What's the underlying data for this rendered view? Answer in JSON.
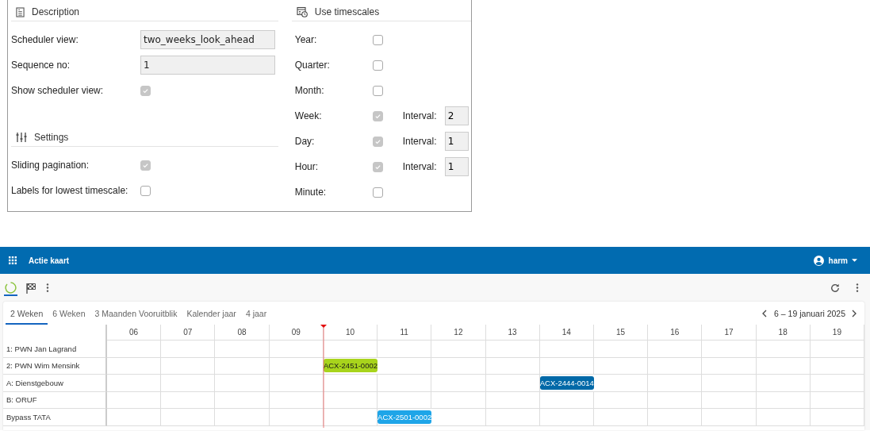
{
  "description": {
    "title": "Description",
    "fields": [
      {
        "label": "Scheduler view:",
        "kind": "text",
        "value": "two_weeks_look_ahead"
      },
      {
        "label": "Sequence no:",
        "kind": "text",
        "value": "1"
      },
      {
        "label": "Show scheduler view:",
        "kind": "checkbox",
        "checked": true
      }
    ]
  },
  "settings": {
    "title": "Settings",
    "fields": [
      {
        "label": "Sliding pagination:",
        "kind": "checkbox",
        "checked": true
      },
      {
        "label": "Labels for lowest timescale:",
        "kind": "checkbox",
        "checked": false
      }
    ]
  },
  "timescales": {
    "title": "Use timescales",
    "rows": [
      {
        "label": "Year:",
        "checked": false
      },
      {
        "label": "Quarter:",
        "checked": false
      },
      {
        "label": "Month:",
        "checked": false
      },
      {
        "label": "Week:",
        "checked": true,
        "interval": {
          "label": "Interval:",
          "value": "2"
        }
      },
      {
        "label": "Day:",
        "checked": true,
        "interval": {
          "label": "Interval:",
          "value": "1"
        }
      },
      {
        "label": "Hour:",
        "checked": true,
        "interval": {
          "label": "Interval:",
          "value": "1"
        }
      },
      {
        "label": "Minute:",
        "checked": false
      }
    ]
  },
  "app_bar": {
    "title": "Actie kaart",
    "user": "harm"
  },
  "tabs": [
    {
      "label": "2 Weken",
      "selected": true
    },
    {
      "label": "6 Weken",
      "selected": false
    },
    {
      "label": "3 Maanden Vooruitblik",
      "selected": false
    },
    {
      "label": "Kalender jaar",
      "selected": false
    },
    {
      "label": "4 jaar",
      "selected": false
    }
  ],
  "date_range": "6 – 19 januari 2025",
  "days": [
    {
      "label": "06",
      "today": false
    },
    {
      "label": "07",
      "today": false
    },
    {
      "label": "08",
      "today": false
    },
    {
      "label": "09",
      "today": false
    },
    {
      "label": "10",
      "today": true
    },
    {
      "label": "11",
      "today": false
    },
    {
      "label": "12",
      "today": false
    },
    {
      "label": "13",
      "today": false
    },
    {
      "label": "14",
      "today": false
    },
    {
      "label": "15",
      "today": false
    },
    {
      "label": "16",
      "today": false
    },
    {
      "label": "17",
      "today": false
    },
    {
      "label": "18",
      "today": false
    },
    {
      "label": "19",
      "today": false
    }
  ],
  "resources": [
    {
      "name": "1: PWN Jan Lagrand",
      "cells": [
        {
          "kind": "empty"
        },
        {
          "kind": "empty"
        },
        {
          "kind": "empty"
        },
        {
          "kind": "empty"
        },
        {
          "kind": "empty"
        },
        {
          "kind": "empty"
        },
        {
          "kind": "empty"
        },
        {
          "kind": "empty"
        },
        {
          "kind": "empty"
        },
        {
          "kind": "empty"
        },
        {
          "kind": "empty"
        },
        {
          "kind": "empty"
        },
        {
          "kind": "empty"
        },
        {
          "kind": "empty"
        }
      ]
    },
    {
      "name": "2: PWN Wim Mensink",
      "cells": [
        {
          "kind": "empty"
        },
        {
          "kind": "empty"
        },
        {
          "kind": "empty"
        },
        {
          "kind": "empty"
        },
        {
          "kind": "event",
          "label": "ACX-2451-0002",
          "color": "#a8d41c"
        },
        {
          "kind": "empty"
        },
        {
          "kind": "empty"
        },
        {
          "kind": "empty"
        },
        {
          "kind": "empty"
        },
        {
          "kind": "empty"
        },
        {
          "kind": "empty"
        },
        {
          "kind": "empty"
        },
        {
          "kind": "empty"
        },
        {
          "kind": "empty"
        }
      ]
    },
    {
      "name": "A: Dienstgebouw",
      "cells": [
        {
          "kind": "empty"
        },
        {
          "kind": "empty"
        },
        {
          "kind": "empty"
        },
        {
          "kind": "empty"
        },
        {
          "kind": "empty"
        },
        {
          "kind": "empty"
        },
        {
          "kind": "empty"
        },
        {
          "kind": "empty"
        },
        {
          "kind": "event",
          "label": "ACX-2444-0014",
          "color": "#0169a8"
        },
        {
          "kind": "empty"
        },
        {
          "kind": "empty"
        },
        {
          "kind": "empty"
        },
        {
          "kind": "empty"
        },
        {
          "kind": "empty"
        }
      ]
    },
    {
      "name": "B: ORUF",
      "cells": [
        {
          "kind": "empty"
        },
        {
          "kind": "empty"
        },
        {
          "kind": "empty"
        },
        {
          "kind": "empty"
        },
        {
          "kind": "empty"
        },
        {
          "kind": "empty"
        },
        {
          "kind": "empty"
        },
        {
          "kind": "empty"
        },
        {
          "kind": "empty"
        },
        {
          "kind": "empty"
        },
        {
          "kind": "empty"
        },
        {
          "kind": "empty"
        },
        {
          "kind": "empty"
        },
        {
          "kind": "empty"
        }
      ]
    },
    {
      "name": "Bypass TATA",
      "cells": [
        {
          "kind": "empty"
        },
        {
          "kind": "empty"
        },
        {
          "kind": "empty"
        },
        {
          "kind": "empty"
        },
        {
          "kind": "empty"
        },
        {
          "kind": "event",
          "label": "ACX-2501-0002",
          "color": "#1ea5e8"
        },
        {
          "kind": "empty"
        },
        {
          "kind": "empty"
        },
        {
          "kind": "empty"
        },
        {
          "kind": "empty"
        },
        {
          "kind": "empty"
        },
        {
          "kind": "empty"
        },
        {
          "kind": "empty"
        },
        {
          "kind": "empty"
        }
      ]
    }
  ]
}
